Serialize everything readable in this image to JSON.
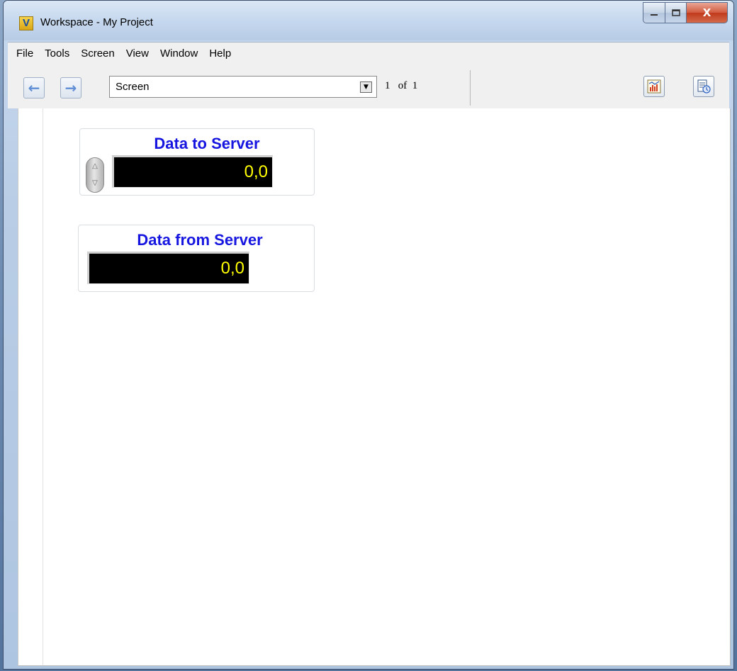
{
  "window": {
    "title": "Workspace - My Project",
    "app_icon_letter": "V",
    "controls": {
      "minimize_icon": "minimize-icon",
      "maximize_icon": "maximize-icon",
      "close_label": "X"
    }
  },
  "menu": {
    "items": [
      "File",
      "Tools",
      "Screen",
      "View",
      "Window",
      "Help"
    ]
  },
  "toolbar": {
    "back_icon": "←",
    "forward_icon": "→",
    "screen_select_value": "Screen",
    "page_current": "1",
    "page_of": "of",
    "page_total": "1",
    "chart_button_icon": "chart-icon",
    "properties_button_icon": "properties-icon"
  },
  "controls": {
    "data_to_server": {
      "label": "Data to Server",
      "value": "0,0"
    },
    "data_from_server": {
      "label": "Data from Server",
      "value": "0,0"
    }
  },
  "colors": {
    "label_blue": "#1616e0",
    "display_yellow": "#ffff00",
    "display_background": "#000000"
  }
}
